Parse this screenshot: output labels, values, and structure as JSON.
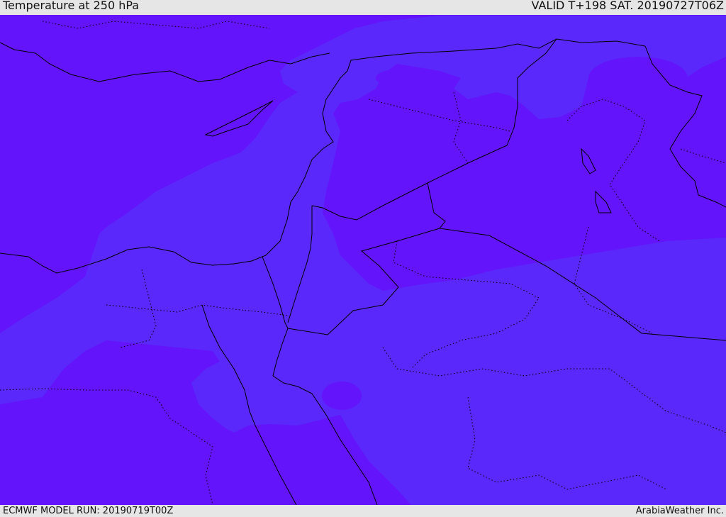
{
  "header": {
    "title": "Temperature at 250 hPa",
    "valid": "VALID T+198 SAT. 20190727T06Z"
  },
  "footer": {
    "model_run": "ECMWF MODEL RUN: 20190719T00Z",
    "credit": "ArabiaWeather Inc."
  },
  "colors": {
    "colder_band": "#6414fa",
    "warmer_band": "#5a28fa",
    "border_line": "#000000"
  }
}
